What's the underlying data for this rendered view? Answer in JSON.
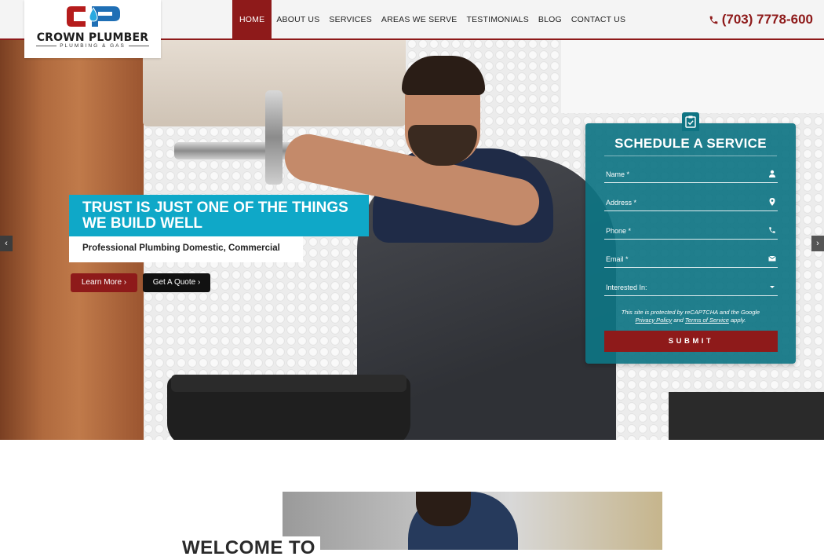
{
  "logo": {
    "name": "CROWN PLUMBER",
    "sub": "PLUMBING & GAS"
  },
  "nav": {
    "items": [
      "HOME",
      "ABOUT US",
      "SERVICES",
      "AREAS WE SERVE",
      "TESTIMONIALS",
      "BLOG",
      "CONTACT US"
    ],
    "active": "HOME"
  },
  "phone": "(703) 7778-600",
  "hero": {
    "tagline": "TRUST IS JUST ONE OF THE THINGS WE BUILD WELL",
    "subline": "Professional Plumbing Domestic, Commercial",
    "learn_more": "Learn More ›",
    "get_quote": "Get A Quote ›",
    "prev": "‹",
    "next": "›"
  },
  "form": {
    "title": "SCHEDULE A SERVICE",
    "fields": {
      "name": "Name *",
      "address": "Address *",
      "phone": "Phone *",
      "email": "Email *",
      "interested": "Interested In:"
    },
    "recaptcha_1": "This site is protected by reCAPTCHA and the Google",
    "privacy": "Privacy Policy",
    "and": "and",
    "terms": "Terms of Service",
    "apply": "apply.",
    "submit": "SUBMIT"
  },
  "welcome": {
    "title": "WELCOME TO"
  },
  "colors": {
    "brand_red": "#8e1a1a",
    "teal": "#0e7483",
    "cyan": "#0fa8c8"
  }
}
